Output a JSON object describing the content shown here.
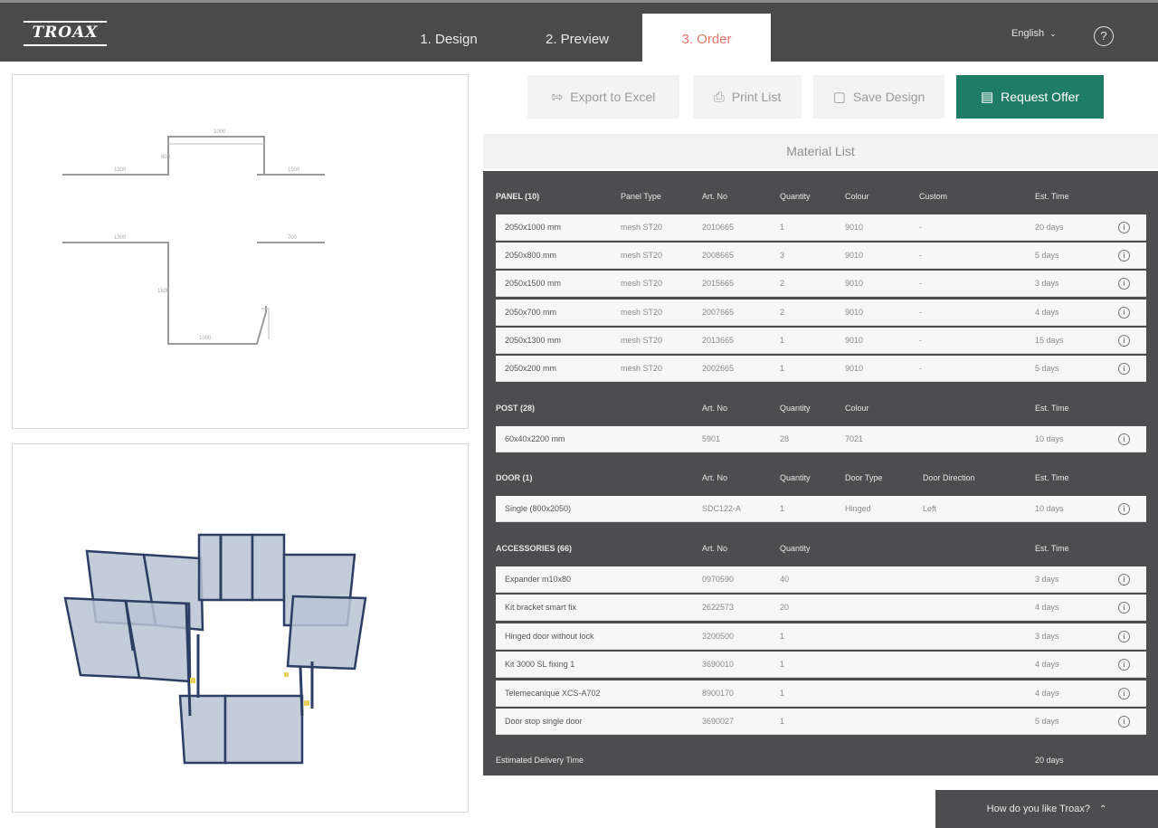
{
  "brand": {
    "logo_text": "TROAX"
  },
  "nav": {
    "tabs": [
      {
        "label": "1. Design",
        "active": false
      },
      {
        "label": "2. Preview",
        "active": false
      },
      {
        "label": "3. Order",
        "active": true
      }
    ],
    "language": "English",
    "help_icon": "help-icon"
  },
  "actions": {
    "export_label": "Export to Excel",
    "print_label": "Print List",
    "save_label": "Save Design",
    "request_label": "Request Offer"
  },
  "colors": {
    "header": "#4a4a4b",
    "accent": "#1e7d64",
    "active_tab": "#e8776f",
    "list_bg": "#4d4d4f"
  },
  "material_list": {
    "title": "Material List",
    "panels": {
      "title": "PANEL (10)",
      "headers": {
        "type": "Panel Type",
        "art": "Art. No",
        "qty": "Quantity",
        "colour": "Colour",
        "custom": "Custom",
        "time": "Est. Time"
      },
      "rows": [
        {
          "name": "2050x1000 mm",
          "type": "mesh ST20",
          "art": "2010665",
          "qty": "1",
          "colour": "9010",
          "custom": "-",
          "time": "20 days"
        },
        {
          "name": "2050x800 mm",
          "type": "mesh ST20",
          "art": "2008665",
          "qty": "3",
          "colour": "9010",
          "custom": "-",
          "time": "5 days"
        },
        {
          "name": "2050x1500 mm",
          "type": "mesh ST20",
          "art": "2015665",
          "qty": "2",
          "colour": "9010",
          "custom": "-",
          "time": "3 days"
        },
        {
          "name": "2050x700 mm",
          "type": "mesh ST20",
          "art": "2007665",
          "qty": "2",
          "colour": "9010",
          "custom": "-",
          "time": "4 days"
        },
        {
          "name": "2050x1300 mm",
          "type": "mesh ST20",
          "art": "2013665",
          "qty": "1",
          "colour": "9010",
          "custom": "-",
          "time": "15 days"
        },
        {
          "name": "2050x200 mm",
          "type": "mesh ST20",
          "art": "2002665",
          "qty": "1",
          "colour": "9010",
          "custom": "-",
          "time": "5 days"
        }
      ]
    },
    "posts": {
      "title": "POST (28)",
      "headers": {
        "art": "Art. No",
        "qty": "Quantity",
        "colour": "Colour",
        "time": "Est. Time"
      },
      "rows": [
        {
          "name": "60x40x2200 mm",
          "art": "5901",
          "qty": "28",
          "colour": "7021",
          "time": "10 days"
        }
      ]
    },
    "doors": {
      "title": "DOOR (1)",
      "headers": {
        "art": "Art. No",
        "qty": "Quantity",
        "door_type": "Door Type",
        "direction": "Door Direction",
        "time": "Est. Time"
      },
      "rows": [
        {
          "name": "Single (800x2050)",
          "art": "SDC122-A",
          "qty": "1",
          "door_type": "Hinged",
          "direction": "Left",
          "time": "10 days"
        }
      ]
    },
    "accessories": {
      "title": "ACCESSORIES (66)",
      "headers": {
        "art": "Art. No",
        "qty": "Quantity",
        "time": "Est. Time"
      },
      "rows": [
        {
          "name": "Expander m10x80",
          "art": "0970590",
          "qty": "40",
          "time": "3 days"
        },
        {
          "name": "Kit bracket smart fix",
          "art": "2622573",
          "qty": "20",
          "time": "4 days"
        },
        {
          "name": "Hinged door without lock",
          "art": "3200500",
          "qty": "1",
          "time": "3 days"
        },
        {
          "name": "Kit 3000 SL fixing 1",
          "art": "3690010",
          "qty": "1",
          "time": "4 days"
        },
        {
          "name": "Telemecanique XCS-A702",
          "art": "8900170",
          "qty": "1",
          "time": "4 days"
        },
        {
          "name": "Door stop single door",
          "art": "3690027",
          "qty": "1",
          "time": "5 days"
        }
      ]
    },
    "estimated_label": "Estimated Delivery Time",
    "estimated_value": "20 days"
  },
  "feedback": {
    "label": "How do you like Troax?"
  }
}
